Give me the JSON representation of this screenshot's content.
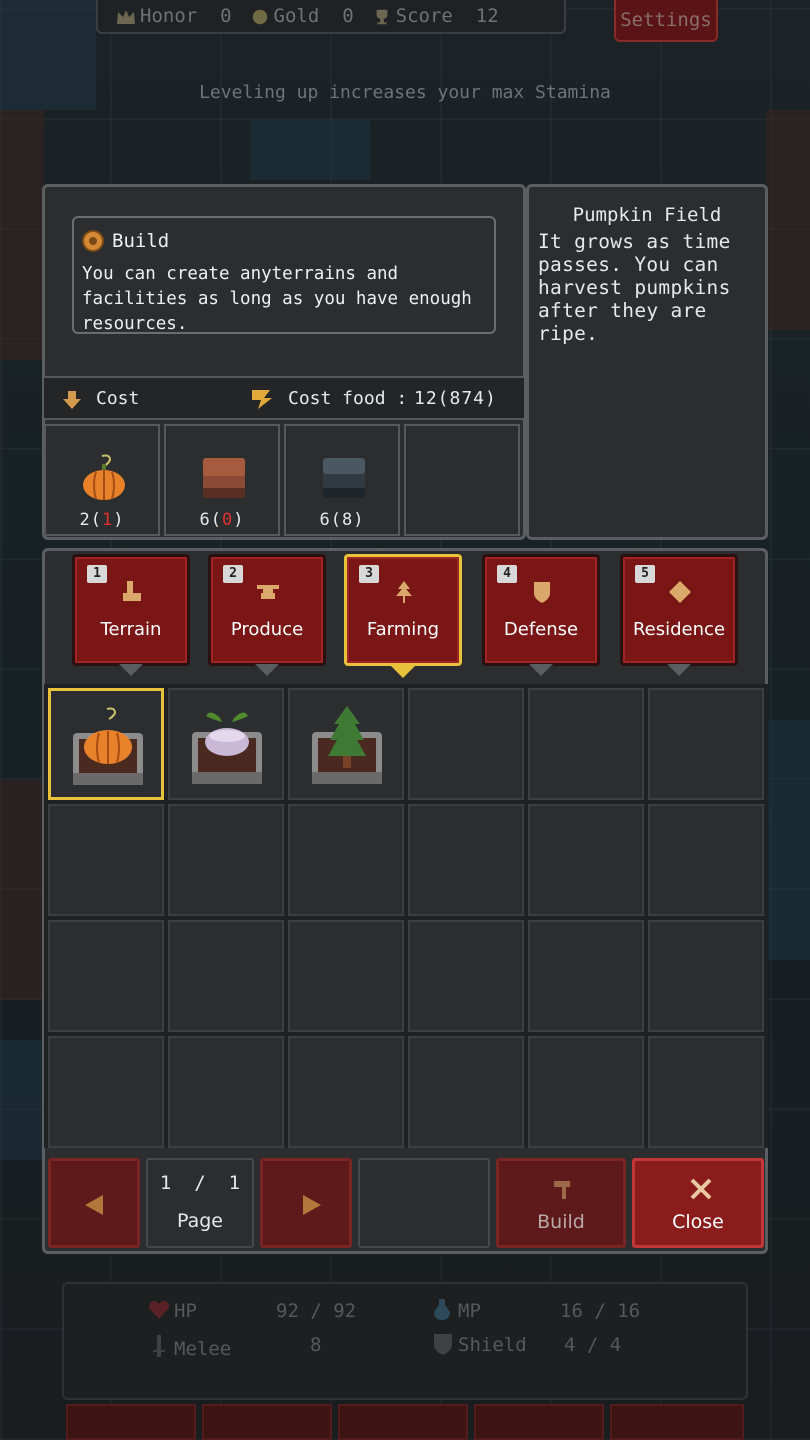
{
  "topbar": {
    "honor_label": "Honor",
    "honor_value": "0",
    "gold_label": "Gold",
    "gold_value": "0",
    "score_label": "Score",
    "score_value": "12",
    "settings_label": "Settings"
  },
  "hint": "Leveling up increases your max Stamina",
  "build": {
    "title": "Build",
    "description": "You can create anyterrains and facilities as long as you have enough resources."
  },
  "info": {
    "title": "Pumpkin Field",
    "text": "It grows as time passes. You can harvest pumpkins after they are ripe."
  },
  "cost": {
    "label": "Cost",
    "food_label": "Cost food :",
    "food_value": "12(874)"
  },
  "resources": [
    {
      "icon": "pumpkin-icon",
      "qty_main": "2(",
      "qty_have": "1",
      "qty_end": ")",
      "have_color": "#e03030"
    },
    {
      "icon": "dirt-block-icon",
      "qty_main": "6(",
      "qty_have": "0",
      "qty_end": ")",
      "have_color": "#e03030"
    },
    {
      "icon": "stone-block-icon",
      "qty_main": "6(",
      "qty_have": "8",
      "qty_end": ")",
      "have_color": "#e8e8e8"
    }
  ],
  "tabs": [
    {
      "num": "1",
      "label": "Terrain"
    },
    {
      "num": "2",
      "label": "Produce"
    },
    {
      "num": "3",
      "label": "Farming",
      "active": true
    },
    {
      "num": "4",
      "label": "Defense"
    },
    {
      "num": "5",
      "label": "Residence"
    }
  ],
  "items": [
    {
      "name": "pumpkin-field-icon",
      "selected": true
    },
    {
      "name": "turnip-field-icon"
    },
    {
      "name": "tree-planter-icon"
    }
  ],
  "pager": {
    "current": "1",
    "sep": "/",
    "total": "1",
    "label": "Page"
  },
  "buttons": {
    "build": "Build",
    "close": "Close"
  },
  "status": {
    "hp_label": "HP",
    "hp_value": "92 / 92",
    "mp_label": "MP",
    "mp_value": "16 / 16",
    "melee_label": "Melee",
    "melee_value": "8",
    "shield_label": "Shield",
    "shield_value": "4 / 4"
  },
  "colors": {
    "accent_gold": "#e8c23a",
    "button_red": "#7a1616",
    "panel": "#2b2d2f"
  }
}
